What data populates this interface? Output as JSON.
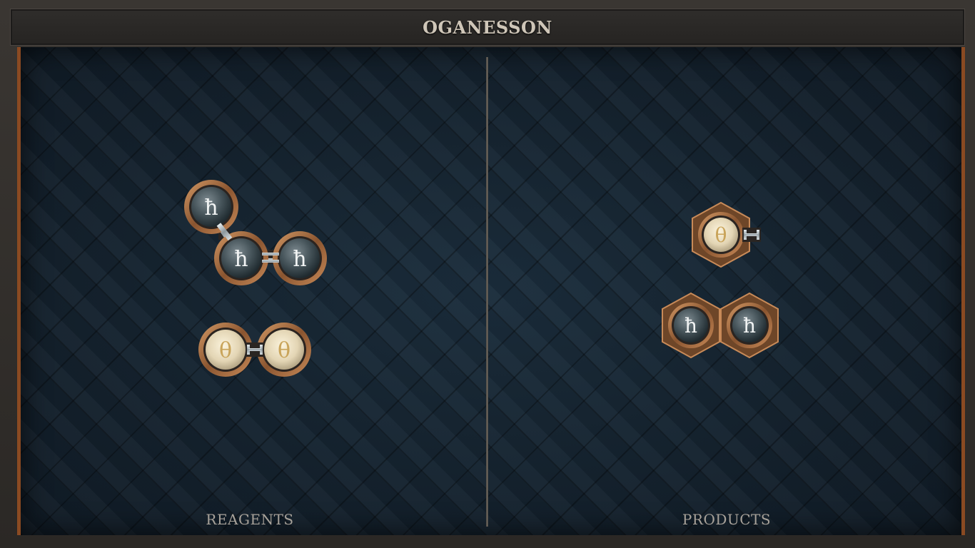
{
  "title": "OGANESSON",
  "reagents": {
    "label": "REAGENTS",
    "molecules": [
      {
        "name": "hydrogen-chain",
        "atoms": [
          "ħ",
          "ħ",
          "ħ"
        ]
      },
      {
        "name": "oxygen-pair",
        "atoms": [
          "θ",
          "θ"
        ]
      }
    ]
  },
  "products": {
    "label": "PRODUCTS",
    "molecules": [
      {
        "name": "oxygen-with-bond",
        "atoms": [
          "θ"
        ]
      },
      {
        "name": "hydrogen-pair",
        "atoms": [
          "ħ",
          "ħ"
        ]
      }
    ]
  },
  "colors": {
    "frame": "#2b2825",
    "board": "#12202c",
    "copper": "#8a4a22",
    "hydrogen_atom": "#4d5a60",
    "oxygen_atom": "#e8dcc0",
    "label_text": "#a8a29a",
    "title_text": "#cfc6b8"
  },
  "icons": {
    "hydrogen": "hydrogen-symbol-icon",
    "oxygen": "oxygen-symbol-icon"
  }
}
